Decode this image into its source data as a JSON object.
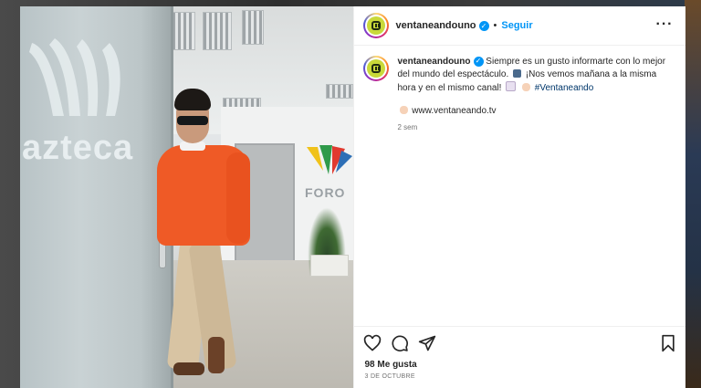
{
  "post": {
    "username": "ventaneandouno",
    "follow_label": "Seguir",
    "more_label": "···",
    "caption_part1": "Siempre es un gusto informarte con lo mejor del mundo del espectáculo.",
    "caption_part2": "¡Nos vemos mañana a la misma hora y en el mismo canal!",
    "hashtag": "#Ventaneando",
    "link_text": "www.ventaneando.tv",
    "time_ago": "2 sem",
    "likes": "98 Me gusta",
    "date": "3 DE OCTUBRE"
  },
  "photo": {
    "glass_text": "azteca",
    "sign_text": "FORO"
  },
  "icons": {
    "verified": "verified-badge-icon",
    "like": "heart-icon",
    "comment": "comment-icon",
    "share": "paper-plane-icon",
    "save": "bookmark-icon",
    "pointer": "pointing-hand-icon"
  },
  "colors": {
    "accent": "#0095f6",
    "hashtag": "#00376b",
    "text": "#262626",
    "muted": "#737373"
  }
}
